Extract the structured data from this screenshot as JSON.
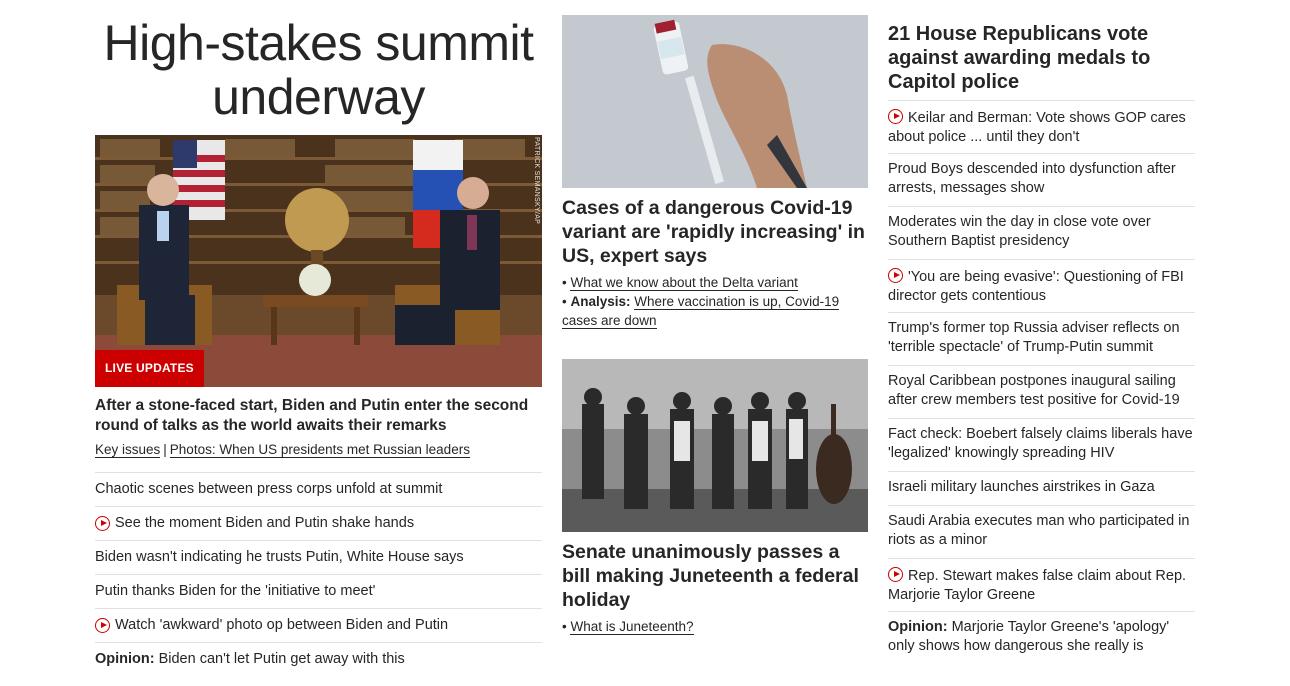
{
  "left": {
    "headline": "High-stakes summit underway",
    "badge": "LIVE UPDATES",
    "photo_credit": "PATRICK SEMANSKY/AP",
    "lead": "After a stone-faced start, Biden and Putin enter the second round of talks as the world awaits their remarks",
    "links": [
      "Key issues",
      "Photos: When US presidents met Russian leaders"
    ],
    "items": [
      {
        "text": "Chaotic scenes between press corps unfold at summit",
        "video": false
      },
      {
        "text": "See the moment Biden and Putin shake hands",
        "video": true
      },
      {
        "text": "Biden wasn't indicating he trusts Putin, White House says",
        "video": false
      },
      {
        "text": "Putin thanks Biden for the 'initiative to meet'",
        "video": false
      },
      {
        "text": "Watch 'awkward' photo op between Biden and Putin",
        "video": true
      },
      {
        "label": "Opinion:",
        "text": "Biden can't let Putin get away with this",
        "video": false
      }
    ]
  },
  "middle": {
    "story1": {
      "headline": "Cases of a dangerous Covid-19 variant are 'rapidly increasing' in US, expert says",
      "bullets": [
        {
          "label": "",
          "text": "What we know about the Delta variant"
        },
        {
          "label": "Analysis:",
          "text": "Where vaccination is up, Covid-19 cases are down"
        }
      ]
    },
    "story2": {
      "headline": "Senate unanimously passes a bill making Juneteenth a federal holiday",
      "bullets": [
        {
          "label": "",
          "text": "What is Juneteenth?"
        }
      ]
    }
  },
  "right": {
    "headline": "21 House Republicans vote against awarding medals to Capitol police",
    "items": [
      {
        "text": "Keilar and Berman: Vote shows GOP cares about police ... until they don't",
        "video": true
      },
      {
        "text": "Proud Boys descended into dysfunction after arrests, messages show",
        "video": false
      },
      {
        "text": "Moderates win the day in close vote over Southern Baptist presidency",
        "video": false
      },
      {
        "text": "'You are being evasive': Questioning of FBI director gets contentious",
        "video": true
      },
      {
        "text": "Trump's former top Russia adviser reflects on 'terrible spectacle' of Trump-Putin summit",
        "video": false
      },
      {
        "text": "Royal Caribbean postpones inaugural sailing after crew members test positive for Covid-19",
        "video": false
      },
      {
        "text": "Fact check: Boebert falsely claims liberals have 'legalized' knowingly spreading HIV",
        "video": false
      },
      {
        "text": "Israeli military launches airstrikes in Gaza",
        "video": false
      },
      {
        "text": "Saudi Arabia executes man who participated in riots as a minor",
        "video": false
      },
      {
        "text": "Rep. Stewart makes false claim about Rep. Marjorie Taylor Greene",
        "video": true
      },
      {
        "label": "Opinion:",
        "text": "Marjorie Taylor Greene's 'apology' only shows how dangerous she really is",
        "video": false
      }
    ]
  },
  "colors": {
    "accent_red": "#cc0000",
    "text": "#262626",
    "divider": "#e1e1e1"
  }
}
